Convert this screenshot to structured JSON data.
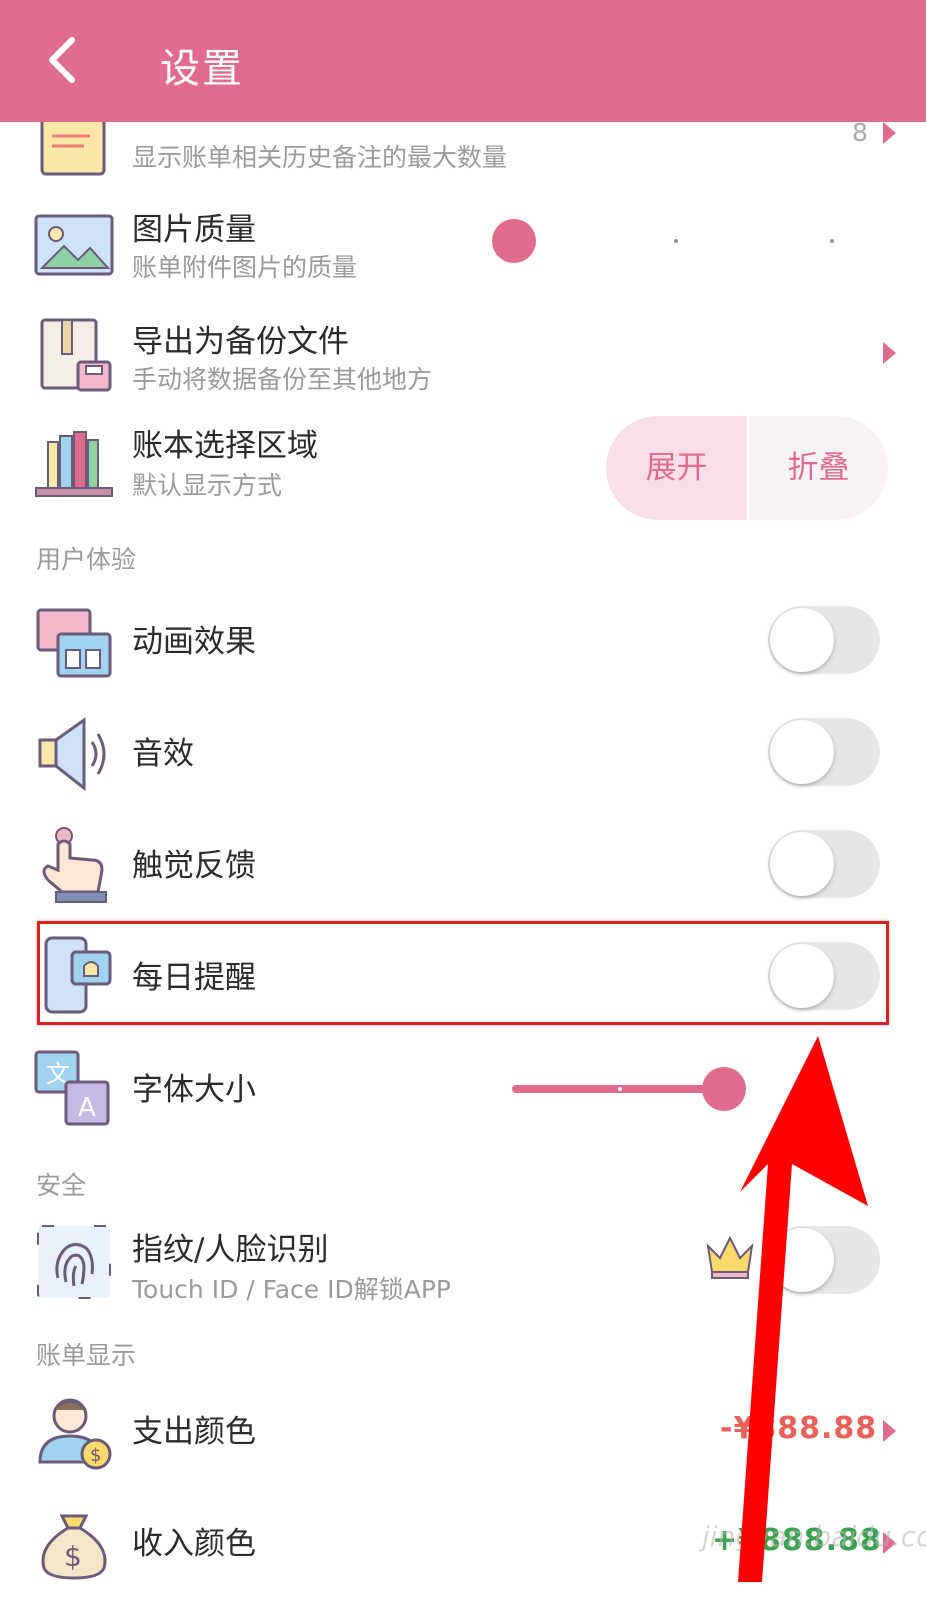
{
  "header": {
    "title": "设置"
  },
  "rows": {
    "notes_max": {
      "subtitle": "显示账单相关历史备注的最大数量",
      "value": "8"
    },
    "image_quality": {
      "title": "图片质量",
      "subtitle": "账单附件图片的质量"
    },
    "export_backup": {
      "title": "导出为备份文件",
      "subtitle": "手动将数据备份至其他地方"
    },
    "book_area": {
      "title": "账本选择区域",
      "subtitle": "默认显示方式",
      "options": [
        "展开",
        "折叠"
      ]
    }
  },
  "sections": {
    "user_experience": "用户体验",
    "security": "安全",
    "bill_display": "账单显示"
  },
  "ux_items": {
    "animation": "动画效果",
    "sound": "音效",
    "haptic": "触觉反馈",
    "daily_reminder": "每日提醒",
    "font_size": "字体大小"
  },
  "security_items": {
    "biometric": {
      "title": "指纹/人脸识别",
      "subtitle": "Touch ID / Face ID解锁APP"
    }
  },
  "bill_items": {
    "expense_color": {
      "title": "支出颜色",
      "value": "-¥888.88"
    },
    "income_color": {
      "title": "收入颜色",
      "value": "+¥888.88"
    }
  },
  "toggles": {
    "animation": false,
    "sound": false,
    "haptic": false,
    "daily_reminder": false,
    "biometric": false
  },
  "sliders": {
    "image_quality_level": 0,
    "font_size_level": 1
  },
  "watermark": "jingyan.baidu.com",
  "colors": {
    "accent": "#e06c8d",
    "expense": "#e8605a",
    "income": "#3aa14e",
    "highlight": "#e02020",
    "annotation_arrow": "#ff0000"
  }
}
